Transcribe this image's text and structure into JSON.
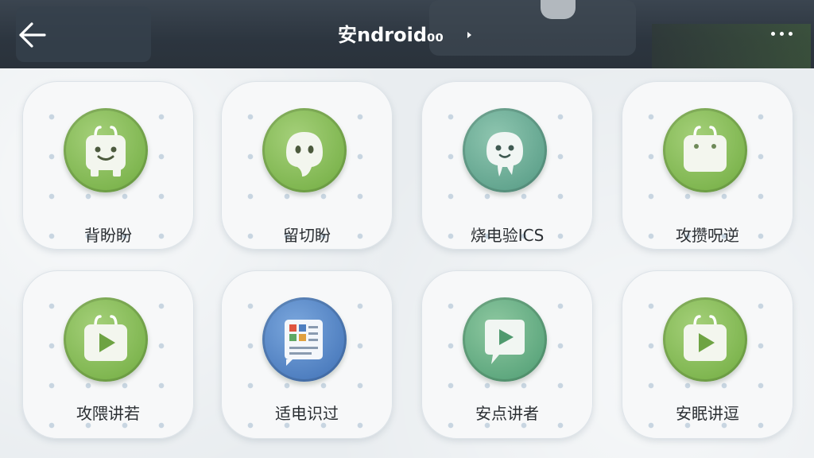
{
  "header": {
    "title": "安ndroid₀₀",
    "back_icon": "arrow-left-icon",
    "title_icon": "caret-right-icon",
    "more_icon": "more-dots-icon"
  },
  "apps": [
    {
      "label": "背盼盼",
      "icon": "bag-face-icon",
      "color": "#7fb650"
    },
    {
      "label": "留切盼",
      "icon": "ghost-icon",
      "color": "#7fb650"
    },
    {
      "label": "烧电验ICS",
      "icon": "ghost-face-icon",
      "color": "#63a58f"
    },
    {
      "label": "攻攒呪逆",
      "icon": "shopping-bag-icon",
      "color": "#7fb650"
    },
    {
      "label": "攻隈讲若",
      "icon": "play-bag-icon",
      "color": "#7fb650"
    },
    {
      "label": "适电识过",
      "icon": "news-icon",
      "color": "#4f7fc0"
    },
    {
      "label": "安点讲者",
      "icon": "play-bubble-icon",
      "color": "#5fa87f"
    },
    {
      "label": "安眠讲逗",
      "icon": "play-bag-icon",
      "color": "#7fb650"
    }
  ]
}
